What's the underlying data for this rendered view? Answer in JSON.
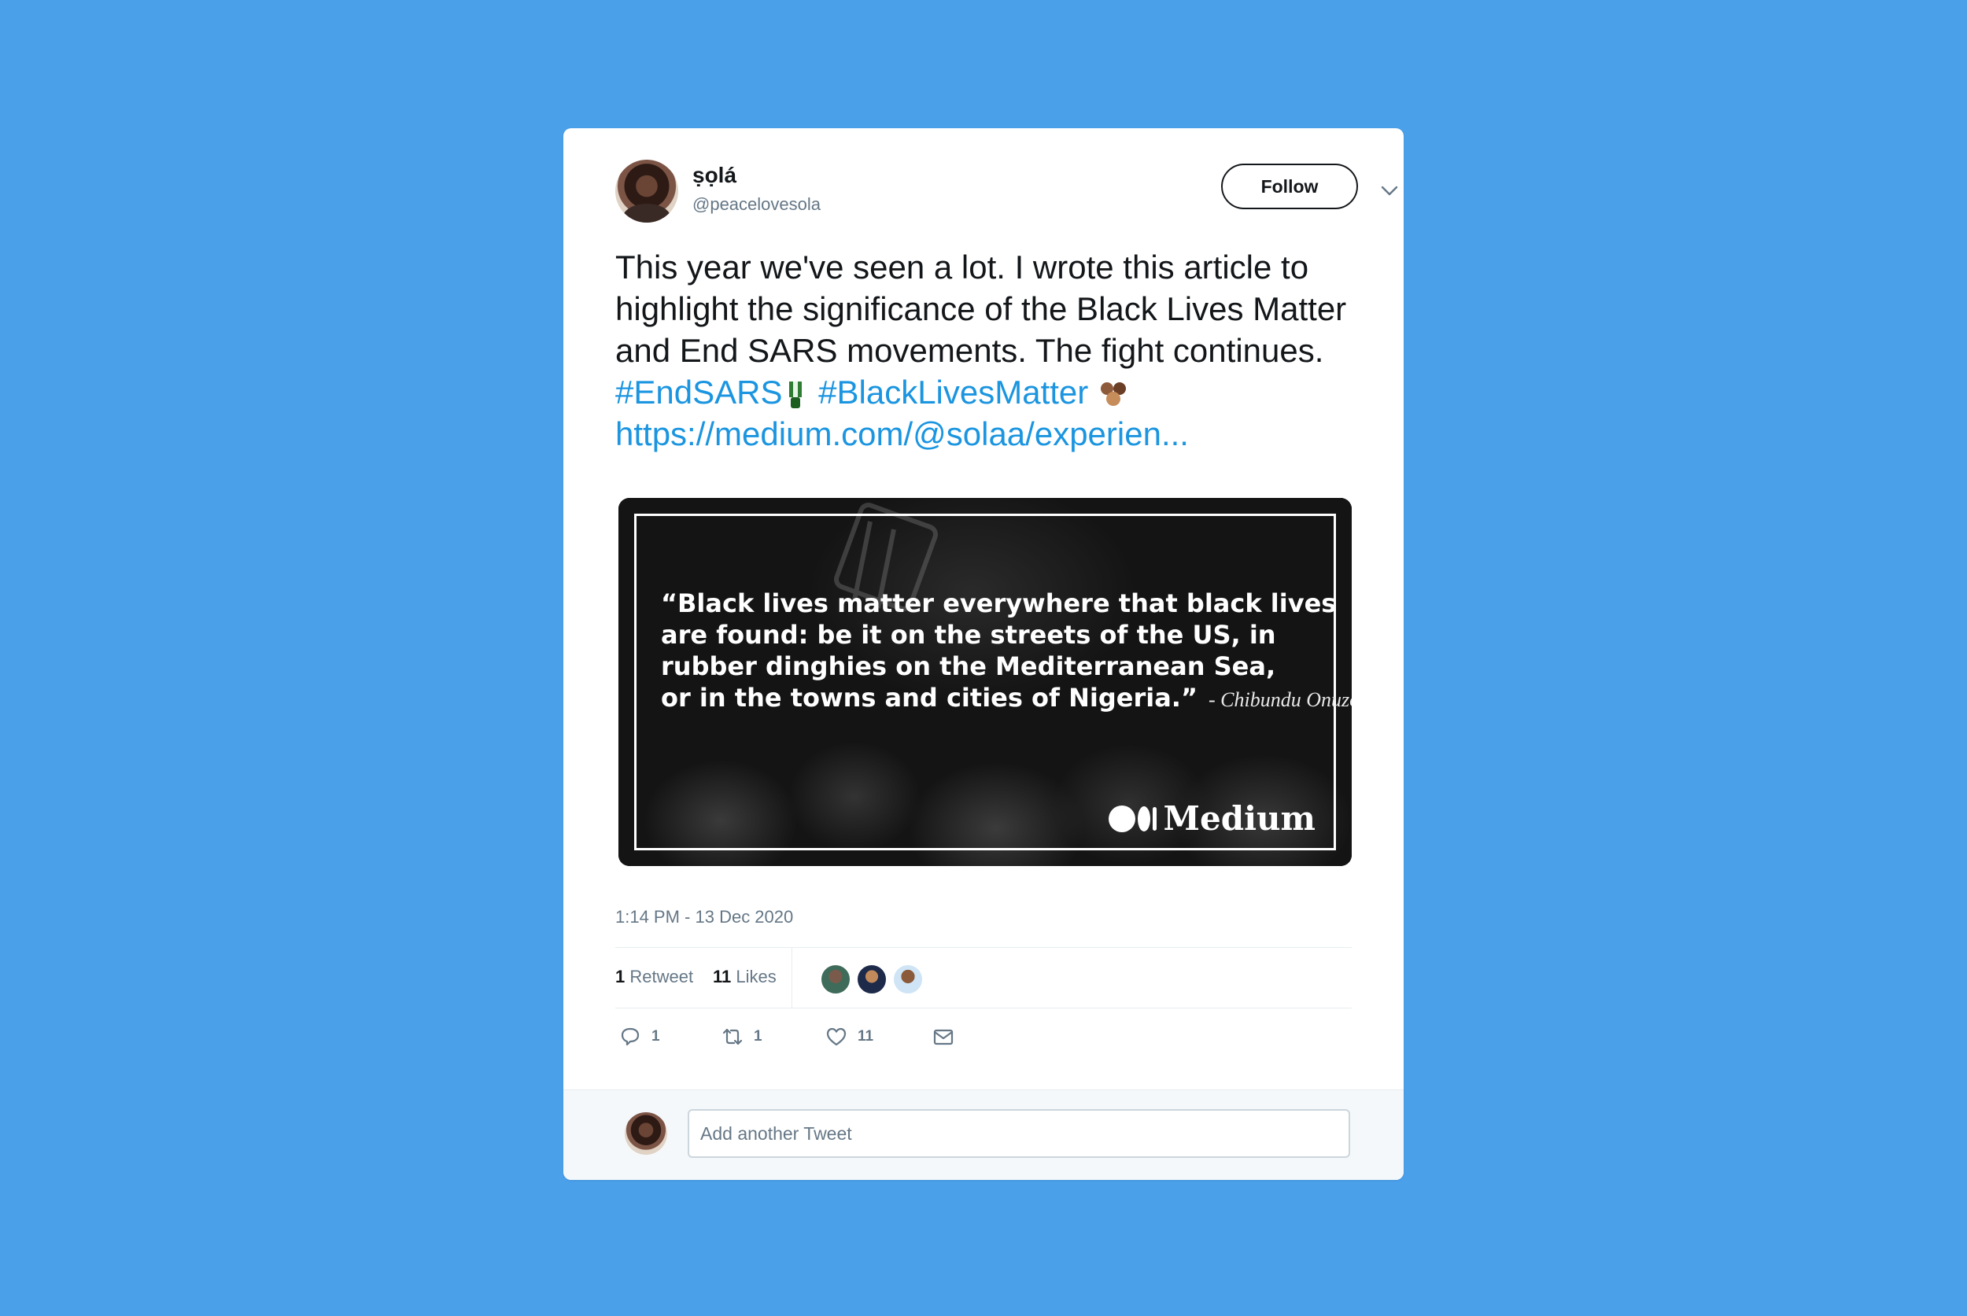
{
  "tweet": {
    "author": {
      "display_name": "ṣọlá",
      "handle": "@peacelovesola"
    },
    "follow_label": "Follow",
    "text_lines": [
      "This year we've seen a lot. I wrote this article to",
      "highlight the significance of the Black Lives Matter",
      "and End SARS movements. The fight continues."
    ],
    "hashtags": [
      "#EndSARS",
      "#BlackLivesMatter"
    ],
    "link": "https://medium.com/@solaa/experien...",
    "media": {
      "quote_lines": [
        "“Black lives matter everywhere that black lives",
        "are found: be it on the streets of the US, in",
        "rubber dinghies on the Mediterranean Sea,",
        "or in the towns and cities of Nigeria.”"
      ],
      "quote_author": "- Chibundu Onuzo",
      "brand": "Medium"
    },
    "timestamp": "1:14 PM - 13 Dec 2020",
    "stats": {
      "retweets_count": "1",
      "retweets_label": "Retweet",
      "likes_count": "11",
      "likes_label": "Likes"
    },
    "actions": {
      "reply_count": "1",
      "retweet_count": "1",
      "like_count": "11"
    },
    "reply_placeholder": "Add another Tweet"
  },
  "colors": {
    "background": "#4ba0ea",
    "link": "#1b95e0",
    "text": "#14171a",
    "muted": "#657786"
  },
  "icons": [
    "caret-down-icon",
    "green-fist-emoji",
    "raised-fists-emoji",
    "reply-icon",
    "retweet-icon",
    "like-icon",
    "message-icon"
  ]
}
